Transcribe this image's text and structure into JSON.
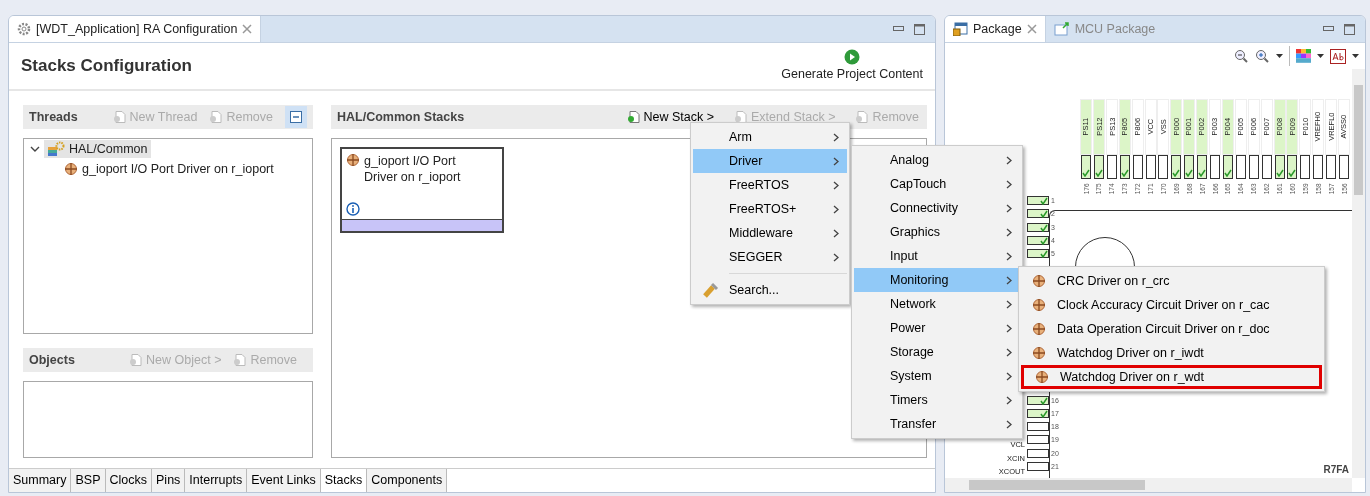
{
  "editor": {
    "tab_title": "[WDT_Application] RA Configuration",
    "heading": "Stacks Configuration",
    "generate_label": "Generate Project Content",
    "threads": {
      "title": "Threads",
      "actions": [
        {
          "label": "New Thread",
          "disabled": true
        },
        {
          "label": "Remove",
          "disabled": true
        }
      ],
      "tree": [
        {
          "label": "HAL/Common",
          "expanded": true,
          "selected": true,
          "children": [
            {
              "label": "g_ioport I/O Port Driver on r_ioport",
              "selected": false
            }
          ]
        }
      ]
    },
    "objects": {
      "title": "Objects",
      "actions": [
        {
          "label": "New Object >",
          "disabled": true
        },
        {
          "label": "Remove",
          "disabled": true
        }
      ]
    },
    "stacks": {
      "title": "HAL/Common Stacks",
      "actions": [
        {
          "label": "New Stack >",
          "disabled": false
        },
        {
          "label": "Extend Stack >",
          "disabled": true
        },
        {
          "label": "Remove",
          "disabled": true
        }
      ],
      "modules": [
        {
          "label": "g_ioport I/O Port Driver on r_ioport"
        }
      ]
    },
    "bottom_tabs": [
      {
        "label": "Summary",
        "selected": false
      },
      {
        "label": "BSP",
        "selected": false
      },
      {
        "label": "Clocks",
        "selected": false
      },
      {
        "label": "Pins",
        "selected": false
      },
      {
        "label": "Interrupts",
        "selected": false
      },
      {
        "label": "Event Links",
        "selected": false
      },
      {
        "label": "Stacks",
        "selected": true
      },
      {
        "label": "Components",
        "selected": false
      }
    ]
  },
  "package": {
    "tabs": [
      {
        "label": "Package",
        "selected": true
      },
      {
        "label": "MCU Package",
        "selected": false
      }
    ],
    "top_pins": [
      {
        "label": "PS11",
        "number": "176",
        "assigned": true
      },
      {
        "label": "PS12",
        "number": "175",
        "assigned": true
      },
      {
        "label": "PS13",
        "number": "174",
        "assigned": false
      },
      {
        "label": "P805",
        "number": "173",
        "assigned": true
      },
      {
        "label": "P806",
        "number": "172",
        "assigned": false
      },
      {
        "label": "VCC",
        "number": "171",
        "assigned": false
      },
      {
        "label": "VSS",
        "number": "170",
        "assigned": false
      },
      {
        "label": "P000",
        "number": "169",
        "assigned": true
      },
      {
        "label": "P001",
        "number": "168",
        "assigned": true
      },
      {
        "label": "P002",
        "number": "167",
        "assigned": true
      },
      {
        "label": "P003",
        "number": "166",
        "assigned": false
      },
      {
        "label": "P004",
        "number": "165",
        "assigned": true
      },
      {
        "label": "P005",
        "number": "164",
        "assigned": false
      },
      {
        "label": "P006",
        "number": "163",
        "assigned": false
      },
      {
        "label": "P007",
        "number": "162",
        "assigned": false
      },
      {
        "label": "P008",
        "number": "161",
        "assigned": true
      },
      {
        "label": "P009",
        "number": "160",
        "assigned": true
      },
      {
        "label": "P010",
        "number": "159",
        "assigned": false
      },
      {
        "label": "VREFH0",
        "number": "158",
        "assigned": false
      },
      {
        "label": "VREFL0",
        "number": "157",
        "assigned": false
      },
      {
        "label": "AVSS0",
        "number": "156",
        "assigned": false
      }
    ],
    "left_pins": [
      {
        "number": "1",
        "assigned": true
      },
      {
        "number": "2",
        "assigned": true
      },
      {
        "number": "3",
        "assigned": true
      },
      {
        "number": "4",
        "assigned": true
      },
      {
        "number": "5",
        "assigned": true
      },
      {
        "number": "16",
        "assigned": true
      },
      {
        "number": "17",
        "assigned": true
      },
      {
        "number": "18",
        "assigned": false
      },
      {
        "label": "VCL",
        "number": "19",
        "assigned": false
      },
      {
        "label": "XCIN",
        "number": "20",
        "assigned": false
      },
      {
        "label": "XCOUT",
        "number": "21",
        "assigned": false
      }
    ],
    "chip_label": "R7FA"
  },
  "menus": [
    {
      "items": [
        {
          "kind": "submenu",
          "label": "Arm",
          "selected": false
        },
        {
          "kind": "submenu",
          "label": "Driver",
          "selected": true
        },
        {
          "kind": "submenu",
          "label": "FreeRTOS",
          "selected": false
        },
        {
          "kind": "submenu",
          "label": "FreeRTOS+",
          "selected": false
        },
        {
          "kind": "submenu",
          "label": "Middleware",
          "selected": false
        },
        {
          "kind": "submenu",
          "label": "SEGGER",
          "selected": false
        },
        {
          "kind": "separator"
        },
        {
          "kind": "search",
          "label": "Search...",
          "selected": false
        }
      ]
    },
    {
      "items": [
        {
          "kind": "submenu",
          "label": "Analog",
          "selected": false
        },
        {
          "kind": "submenu",
          "label": "CapTouch",
          "selected": false
        },
        {
          "kind": "submenu",
          "label": "Connectivity",
          "selected": false
        },
        {
          "kind": "submenu",
          "label": "Graphics",
          "selected": false
        },
        {
          "kind": "submenu",
          "label": "Input",
          "selected": false
        },
        {
          "kind": "submenu",
          "label": "Monitoring",
          "selected": true
        },
        {
          "kind": "submenu",
          "label": "Network",
          "selected": false
        },
        {
          "kind": "submenu",
          "label": "Power",
          "selected": false
        },
        {
          "kind": "submenu",
          "label": "Storage",
          "selected": false
        },
        {
          "kind": "submenu",
          "label": "System",
          "selected": false
        },
        {
          "kind": "submenu",
          "label": "Timers",
          "selected": false
        },
        {
          "kind": "submenu",
          "label": "Transfer",
          "selected": false
        }
      ]
    },
    {
      "items": [
        {
          "kind": "module",
          "label": "CRC Driver on r_crc",
          "selected": false,
          "highlighted": false
        },
        {
          "kind": "module",
          "label": "Clock Accuracy Circuit Driver on r_cac",
          "selected": false,
          "highlighted": false
        },
        {
          "kind": "module",
          "label": "Data Operation Circuit Driver on r_doc",
          "selected": false,
          "highlighted": false
        },
        {
          "kind": "module",
          "label": "Watchdog Driver on r_iwdt",
          "selected": false,
          "highlighted": false
        },
        {
          "kind": "module",
          "label": "Watchdog Driver on r_wdt",
          "selected": false,
          "highlighted": true
        }
      ]
    }
  ]
}
